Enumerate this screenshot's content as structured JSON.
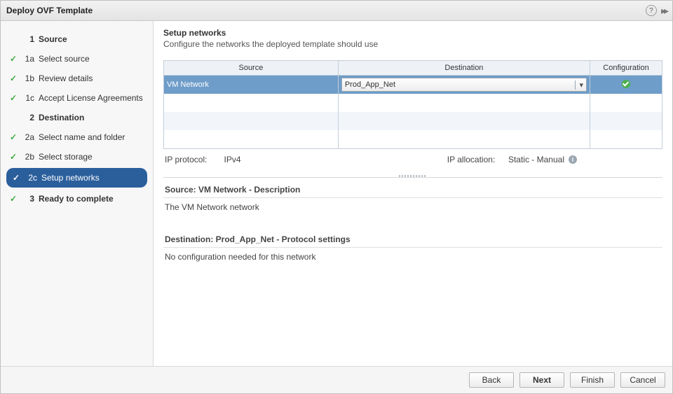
{
  "header": {
    "title": "Deploy OVF Template"
  },
  "sidebar": {
    "s1": {
      "num": "1",
      "label": "Source"
    },
    "s1a": {
      "num": "1a",
      "label": "Select source"
    },
    "s1b": {
      "num": "1b",
      "label": "Review details"
    },
    "s1c": {
      "num": "1c",
      "label": "Accept License Agreements"
    },
    "s2": {
      "num": "2",
      "label": "Destination"
    },
    "s2a": {
      "num": "2a",
      "label": "Select name and folder"
    },
    "s2b": {
      "num": "2b",
      "label": "Select storage"
    },
    "s2c": {
      "num": "2c",
      "label": "Setup networks"
    },
    "s3": {
      "num": "3",
      "label": "Ready to complete"
    }
  },
  "content": {
    "heading": "Setup networks",
    "subheading": "Configure the networks the deployed template should use",
    "table": {
      "cols": {
        "source": "Source",
        "destination": "Destination",
        "config": "Configuration"
      },
      "row": {
        "source": "VM Network",
        "destination": "Prod_App_Net"
      }
    },
    "protocol": {
      "ip_label": "IP protocol:",
      "ip_value": "IPv4",
      "alloc_label": "IP allocation:",
      "alloc_value": "Static - Manual"
    },
    "source_desc_head": "Source: VM Network - Description",
    "source_desc_body": "The VM Network network",
    "dest_desc_head": "Destination: Prod_App_Net - Protocol settings",
    "dest_desc_body": "No configuration needed for this network"
  },
  "footer": {
    "back": "Back",
    "next": "Next",
    "finish": "Finish",
    "cancel": "Cancel"
  }
}
